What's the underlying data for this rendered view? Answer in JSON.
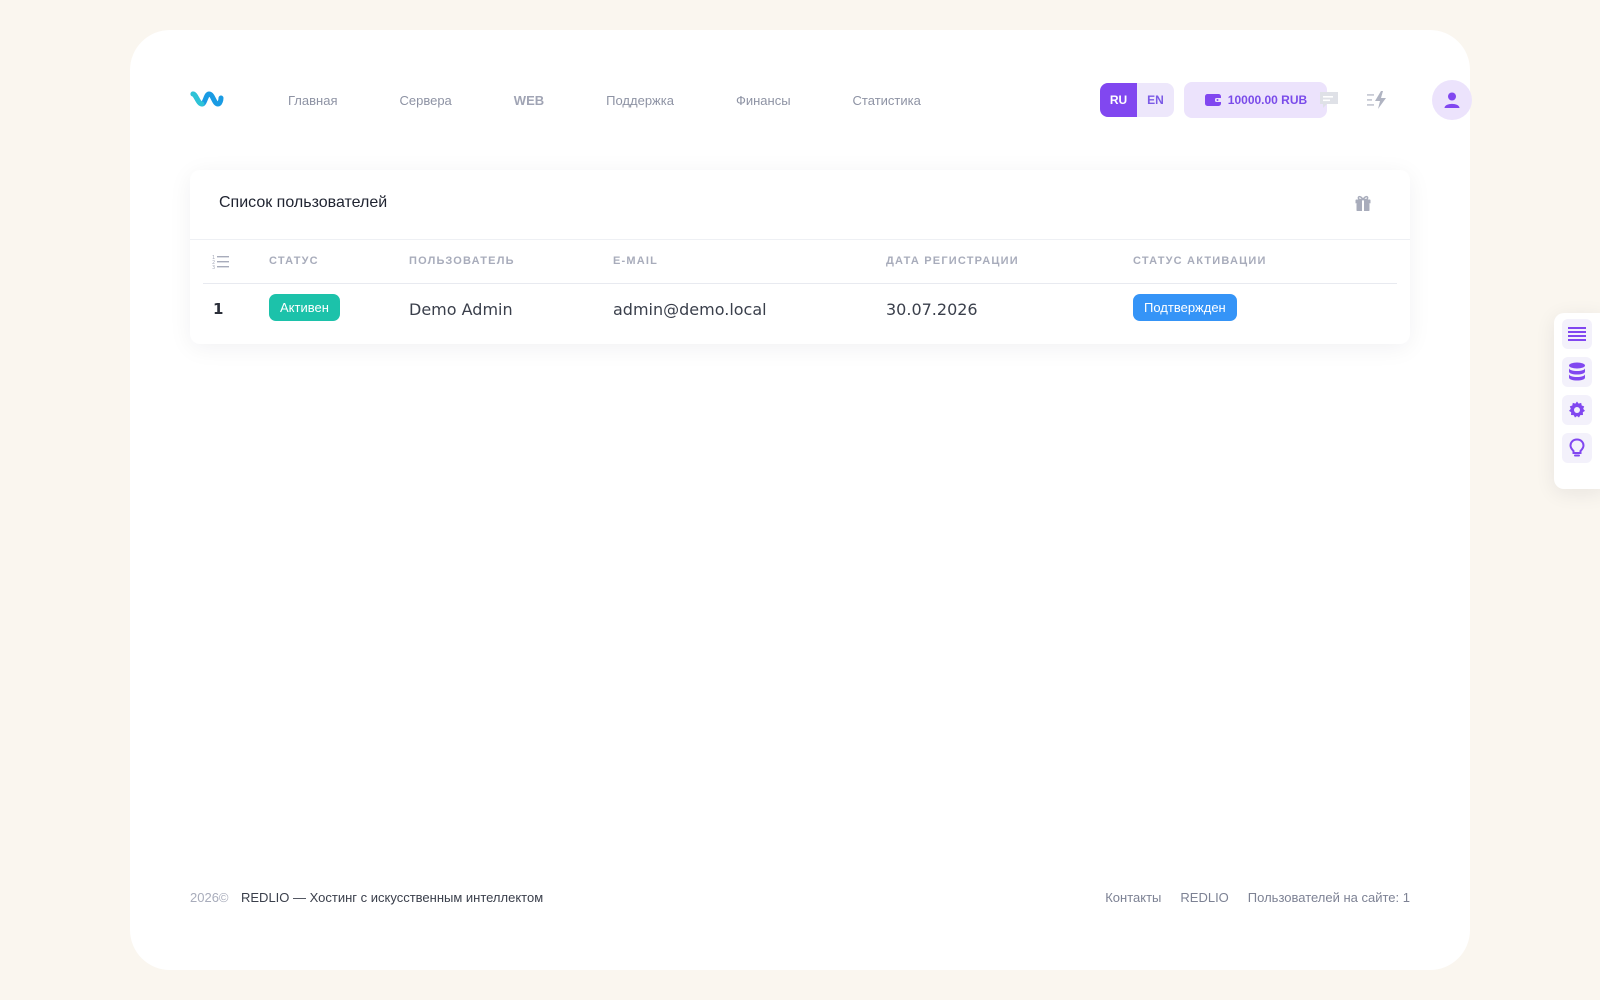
{
  "header": {
    "nav": [
      "Главная",
      "Сервера",
      "WEB",
      "Поддержка",
      "Финансы",
      "Статистика"
    ],
    "lang": {
      "ru": "RU",
      "en": "EN",
      "active": "RU"
    },
    "balance": "10000.00 RUB"
  },
  "card": {
    "title": "Список пользователей",
    "columns": [
      "СТАТУС",
      "ПОЛЬЗОВАТЕЛЬ",
      "E-MAIL",
      "ДАТА РЕГИСТРАЦИИ",
      "СТАТУС АКТИВАЦИИ"
    ],
    "rows": [
      {
        "num": "1",
        "status": "Активен",
        "user": "Demo Admin",
        "email": "admin@demo.local",
        "date": "30.07.2026",
        "activation": "Подтвержден"
      }
    ]
  },
  "footer": {
    "year": "2026©",
    "brand": "REDLIO — Хостинг с искусственным интеллектом",
    "links": [
      "Контакты",
      "REDLIO",
      "Пользователей на сайте: 1"
    ]
  },
  "icons": {
    "logo": "logo-icon",
    "chat": "chat-icon",
    "flash": "flash-icon",
    "avatar": "user-icon",
    "gift": "gift-icon",
    "list": "numbered-list-icon",
    "side": [
      "menu-lines-icon",
      "database-icon",
      "gear-icon",
      "lightbulb-icon"
    ]
  },
  "colors": {
    "accent": "#8147f0",
    "active_badge": "#1cc2aa",
    "confirmed_badge": "#3594f7",
    "page_bg": "#faf6ef"
  }
}
